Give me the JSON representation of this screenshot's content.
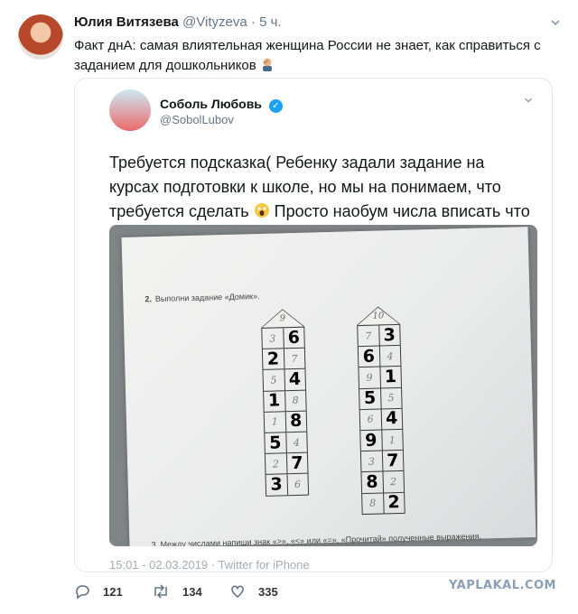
{
  "tweet": {
    "author_name": "Юлия Витязева",
    "author_handle": "@Vityzeva",
    "separator": "·",
    "time": "5 ч.",
    "text": "Факт днА: самая влиятельная женщина России не знает, как справиться с заданием для дошкольников",
    "emoji_icon": "facepalm-emoji"
  },
  "quote": {
    "author_name": "Соболь Любовь",
    "author_handle": "@SobolLubov",
    "verified_icon": "verified-badge-icon",
    "text_part1": "Требуется подсказка( Ребенку задали задание на курсах подготовки к школе, но мы на понимаем, что требуется сделать",
    "text_part2": "Просто наобум числа вписать что ли?))",
    "emoji_icon": "screaming-face-emoji",
    "meta": "15:01 - 02.03.2019 · Twitter for iPhone"
  },
  "worksheet": {
    "task_number": "2.",
    "task_text": "Выполни задание «Домик».",
    "task3_text": "3. Между числами напиши знак «>», «<» или «=». «Прочитай» полученные выражения.",
    "house1": {
      "roof": "9",
      "rows": [
        {
          "printed": "3",
          "printed_side": "left",
          "written": "6"
        },
        {
          "printed": "7",
          "printed_side": "right",
          "written": "2"
        },
        {
          "printed": "5",
          "printed_side": "left",
          "written": "4"
        },
        {
          "printed": "8",
          "printed_side": "right",
          "written": "1"
        },
        {
          "printed": "1",
          "printed_side": "left",
          "written": "8"
        },
        {
          "printed": "4",
          "printed_side": "right",
          "written": "5"
        },
        {
          "printed": "2",
          "printed_side": "left",
          "written": "7"
        },
        {
          "printed": "6",
          "printed_side": "right",
          "written": "3"
        }
      ]
    },
    "house2": {
      "roof": "10",
      "rows": [
        {
          "printed": "7",
          "printed_side": "left",
          "written": "3"
        },
        {
          "printed": "4",
          "printed_side": "right",
          "written": "6"
        },
        {
          "printed": "9",
          "printed_side": "left",
          "written": "1"
        },
        {
          "printed": "5",
          "printed_side": "right",
          "written": "5"
        },
        {
          "printed": "6",
          "printed_side": "left",
          "written": "4"
        },
        {
          "printed": "1",
          "printed_side": "right",
          "written": "9"
        },
        {
          "printed": "3",
          "printed_side": "left",
          "written": "7"
        },
        {
          "printed": "2",
          "printed_side": "right",
          "written": "8"
        },
        {
          "printed": "8",
          "printed_side": "left",
          "written": "2"
        }
      ]
    }
  },
  "actions": {
    "reply_count": "121",
    "retweet_count": "134",
    "like_count": "335"
  },
  "watermark": "YAPLAKAL.COM",
  "colors": {
    "link_blue": "#1da1f2",
    "muted": "#657786",
    "border": "#e1e8ed"
  }
}
